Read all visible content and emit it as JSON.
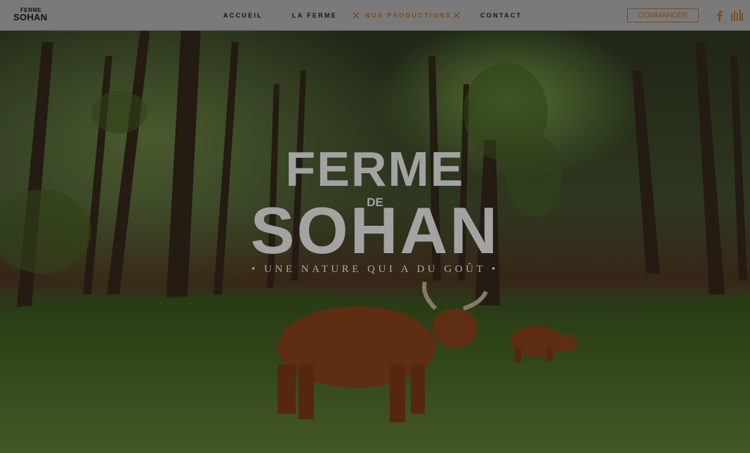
{
  "header": {
    "logo_line1": "FERME",
    "logo_line2": "SOHAN",
    "nav": [
      {
        "label": "ACCUEIL"
      },
      {
        "label": "LA FERME"
      },
      {
        "label": "NOS PRODUCTIONS"
      },
      {
        "label": "CONTACT"
      }
    ],
    "cta_label": "COMMANDER",
    "icons": [
      "facebook-icon",
      "bars-icon",
      "close-icon"
    ]
  },
  "hero": {
    "title_line1": "FERME",
    "title_connector": "DE",
    "title_line2": "SOHAN",
    "tagline": "• UNE NATURE QUI A DU GOÛT •"
  },
  "colors": {
    "header_bg": "#7a7a7a",
    "accent": "#7a4a20",
    "title": "#a3a3a3"
  }
}
